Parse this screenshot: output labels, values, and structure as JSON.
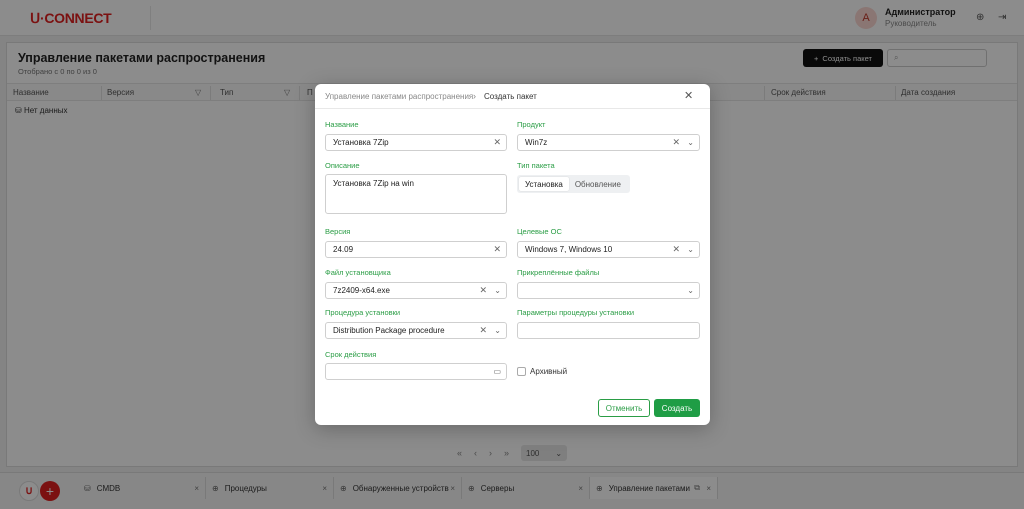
{
  "app": {
    "logo": "CONNECT",
    "user": {
      "initial": "А",
      "name": "Администратор",
      "role": "Руководитель"
    },
    "page_title": "Управление пакетами распространения",
    "page_subtitle": "Отобрано с 0 по 0 из 0",
    "create_button": "Создать пакет",
    "search_icon": "search-icon",
    "columns": [
      "Название",
      "Версия",
      "Тип",
      "П",
      "Срок действия",
      "Дата создания"
    ],
    "no_data": "Нет данных",
    "pager": {
      "first": "«",
      "prev": "‹",
      "next": "›",
      "last": "»",
      "page_size": "100"
    }
  },
  "tabs": [
    {
      "label": "CMDB",
      "icon": "database-icon"
    },
    {
      "label": "Процедуры",
      "icon": "plus-circle-icon"
    },
    {
      "label": "Обнаруженные устройств",
      "icon": "plus-circle-icon"
    },
    {
      "label": "Серверы",
      "icon": "plus-circle-icon"
    },
    {
      "label": "Управление пакетами",
      "icon": "plus-circle-icon",
      "active": true
    }
  ],
  "modal": {
    "breadcrumb_parent": "Управление пакетами распространения",
    "breadcrumb_current": "Создать пакет",
    "name_label": "Название",
    "name_value": "Установка 7Zip",
    "product_label": "Продукт",
    "product_value": "Win7z",
    "description_label": "Описание",
    "description_value": "Установка 7Zip на win",
    "package_type_label": "Тип пакета",
    "package_type_options": [
      "Установка",
      "Обновление"
    ],
    "package_type_selected": "Установка",
    "version_label": "Версия",
    "version_value": "24.09",
    "target_os_label": "Целевые ОС",
    "target_os_value": "Windows 7, Windows 10",
    "installer_label": "Файл установщика",
    "installer_value": "7z2409-x64.exe",
    "attached_label": "Прикреплённые файлы",
    "attached_value": "",
    "procedure_label": "Процедура установки",
    "procedure_value": "Distribution Package procedure",
    "params_label": "Параметры процедуры установки",
    "params_value": "",
    "expiry_label": "Срок действия",
    "expiry_value": "",
    "archived_label": "Архивный",
    "archived_checked": false,
    "cancel_button": "Отменить",
    "submit_button": "Создать"
  },
  "colors": {
    "brand": "#e02020",
    "accent_green": "#1f9d45"
  }
}
